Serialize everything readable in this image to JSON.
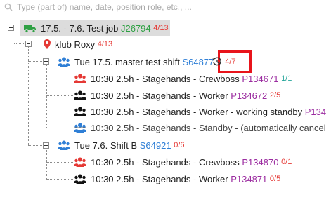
{
  "search": {
    "placeholder": "Type (part of) name, date, position role, etc., ...",
    "value": ""
  },
  "tree": {
    "job": {
      "title": "17.5. - 7.6. Test job",
      "code": "J26794",
      "count": "4/13"
    },
    "location": {
      "title": "klub Roxy",
      "count": "4/13"
    },
    "shift1": {
      "title": "Tue 17.5. master test shift",
      "code": "S64877",
      "count": "4/7"
    },
    "shift1_positions": [
      {
        "time": "10:30 2.5h - Stagehands - Crewboss",
        "code": "P134671",
        "count": "1/1"
      },
      {
        "time": "10:30 2.5h - Stagehands - Worker",
        "code": "P134672",
        "count": "2/5"
      },
      {
        "time": "10:30 2.5h - Stagehands - Worker - working standby",
        "code": "P134"
      },
      {
        "time": "10:30 2.5h - Stagehands - Standby - (automatically cancel"
      }
    ],
    "shift2": {
      "title": "Tue 7.6. Shift B",
      "code": "S64921",
      "count": "0/6"
    },
    "shift2_positions": [
      {
        "time": "10:30 2.5h - Stagehands - Crewboss",
        "code": "P134870",
        "count": "0/1"
      },
      {
        "time": "10:30 2.5h - Stagehands - Worker",
        "code": "P134871",
        "count": "0/5"
      }
    ]
  },
  "colors": {
    "green": "#2ea043",
    "red": "#e53935",
    "blue": "#2f7fd6",
    "purple": "#9b2ca0",
    "teal": "#26a69a",
    "highlight": "#e8141b"
  },
  "icons": [
    "search-icon",
    "truck-icon",
    "map-pin-icon",
    "group-icon",
    "history-icon",
    "person-group-icon"
  ]
}
